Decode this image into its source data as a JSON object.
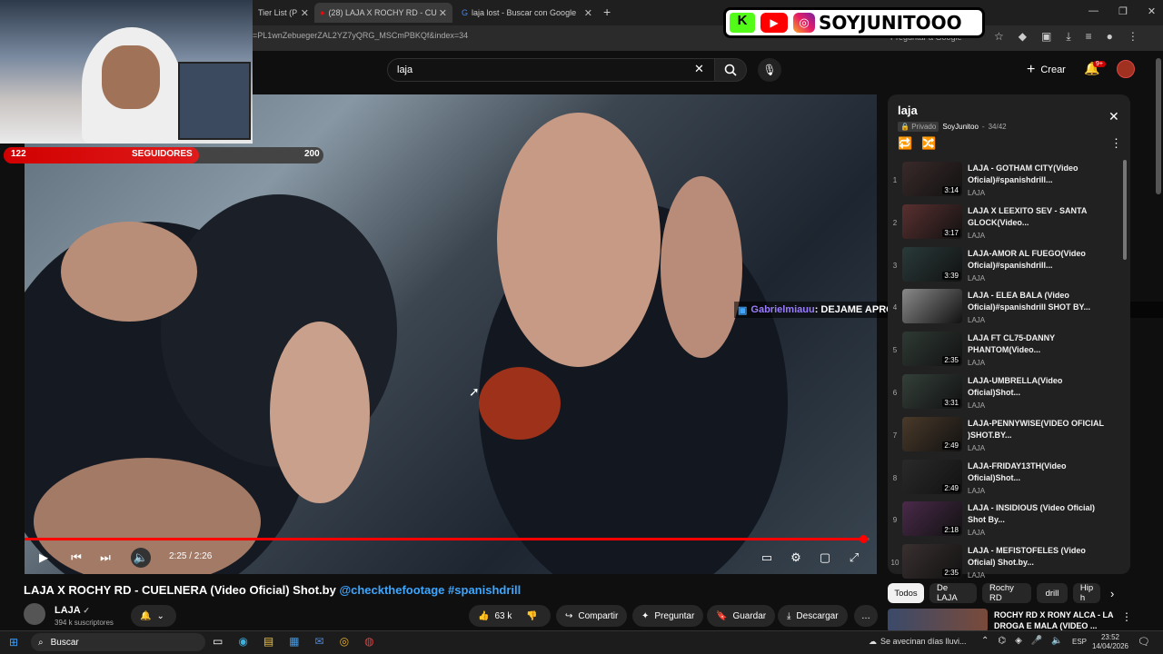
{
  "browser": {
    "tabs": [
      {
        "label": "Tier List (P",
        "active": false
      },
      {
        "label": "(28) LAJA X ROCHY RD - CU",
        "active": true
      },
      {
        "label": "laja lost - Buscar con Google",
        "active": false
      }
    ],
    "new_tab_label": "+",
    "url": "=PL1wnZebuegerZAL2YZ7yQRG_MSCmPBKQf&index=34",
    "google_prompt": "Preguntar a Google"
  },
  "youtube": {
    "search_value": "laja",
    "create_label": "Crear",
    "notifications_badge": "9+"
  },
  "stream_overlay": {
    "followers_current": "122",
    "followers_label": "SEGUIDORES",
    "followers_goal": "200",
    "followers_progress": 0.61,
    "brand": "SOYJUNITOOO",
    "chat_user": "Gabrielmiauu",
    "chat_text": ": DEJAME APROVECHAR Y ROBARTE"
  },
  "player": {
    "time": "2:25 / 2:26",
    "progress": 0.993
  },
  "video": {
    "title": "LAJA X ROCHY RD - CUELNERA (Video Oficial) Shot.by",
    "title_link1": "@checkthefootage",
    "title_link2": "#spanishdrill",
    "channel": "LAJA",
    "subscribers": "394 k suscriptores",
    "likes": "63 k",
    "share_label": "Compartir",
    "ask_label": "Preguntar",
    "save_label": "Guardar",
    "download_label": "Descargar"
  },
  "playlist": {
    "title": "laja",
    "privacy": "Privado",
    "owner": "SoyJunitoo",
    "position": "34/42",
    "items": [
      {
        "num": "1",
        "title": "LAJA - GOTHAM CITY(Video Oficial)#spanishdrill...",
        "channel": "LAJA",
        "duration": "3:14",
        "thumb": "#3a2a2a"
      },
      {
        "num": "2",
        "title": "LAJA X LEEXITO SEV - SANTA GLOCK(Video...",
        "channel": "LAJA",
        "duration": "3:17",
        "thumb": "#5a3030"
      },
      {
        "num": "3",
        "title": "LAJA-AMOR AL FUEGO(Video Oficial)#spanishdrill...",
        "channel": "LAJA",
        "duration": "3:39",
        "thumb": "#2a3a3a"
      },
      {
        "num": "4",
        "title": "LAJA - ELEA BALA (Video Oficial)#spanishdrill SHOT BY...",
        "channel": "LAJA",
        "duration": "",
        "thumb": "#8a8a8a"
      },
      {
        "num": "5",
        "title": "LAJA FT CL75-DANNY PHANTOM(Video...",
        "channel": "LAJA",
        "duration": "2:35",
        "thumb": "#2f3a34"
      },
      {
        "num": "6",
        "title": "LAJA-UMBRELLA(Video Oficial)Shot...",
        "channel": "LAJA",
        "duration": "3:31",
        "thumb": "#34403a"
      },
      {
        "num": "7",
        "title": "LAJA-PENNYWISE(VIDEO OFICIAL )SHOT.BY...",
        "channel": "LAJA",
        "duration": "2:49",
        "thumb": "#4a3a2a"
      },
      {
        "num": "8",
        "title": "LAJA-FRIDAY13TH(Video Oficial)Shot...",
        "channel": "LAJA",
        "duration": "2:49",
        "thumb": "#2a2a2a"
      },
      {
        "num": "9",
        "title": "LAJA - INSIDIOUS (Video Oficial) Shot By...",
        "channel": "LAJA",
        "duration": "2:18",
        "thumb": "#4a2a4a"
      },
      {
        "num": "10",
        "title": "LAJA - MEFISTOFELES (Video Oficial) Shot.by...",
        "channel": "LAJA",
        "duration": "2:35",
        "thumb": "#3a3030"
      }
    ]
  },
  "chips": [
    "Todos",
    "De LAJA",
    "Rochy RD",
    "drill",
    "Hip h"
  ],
  "recommended": {
    "title": "ROCHY RD X RONY ALCA - LA DROGA E MALA (VIDEO ..."
  },
  "taskbar": {
    "search_label": "Buscar",
    "weather": "Se avecinan días lluvi...",
    "lang": "ESP",
    "time": "23:52",
    "date": "14/04/2026"
  }
}
